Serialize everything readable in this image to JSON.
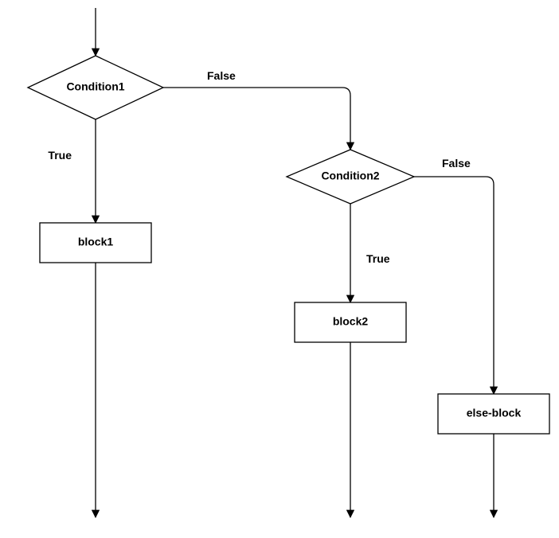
{
  "diagram": {
    "nodes": {
      "condition1": {
        "label": "Condition1"
      },
      "condition2": {
        "label": "Condition2"
      },
      "block1": {
        "label": "block1"
      },
      "block2": {
        "label": "block2"
      },
      "elseBlock": {
        "label": "else-block"
      }
    },
    "edges": {
      "c1True": {
        "label": "True"
      },
      "c1False": {
        "label": "False"
      },
      "c2True": {
        "label": "True"
      },
      "c2False": {
        "label": "False"
      }
    }
  }
}
